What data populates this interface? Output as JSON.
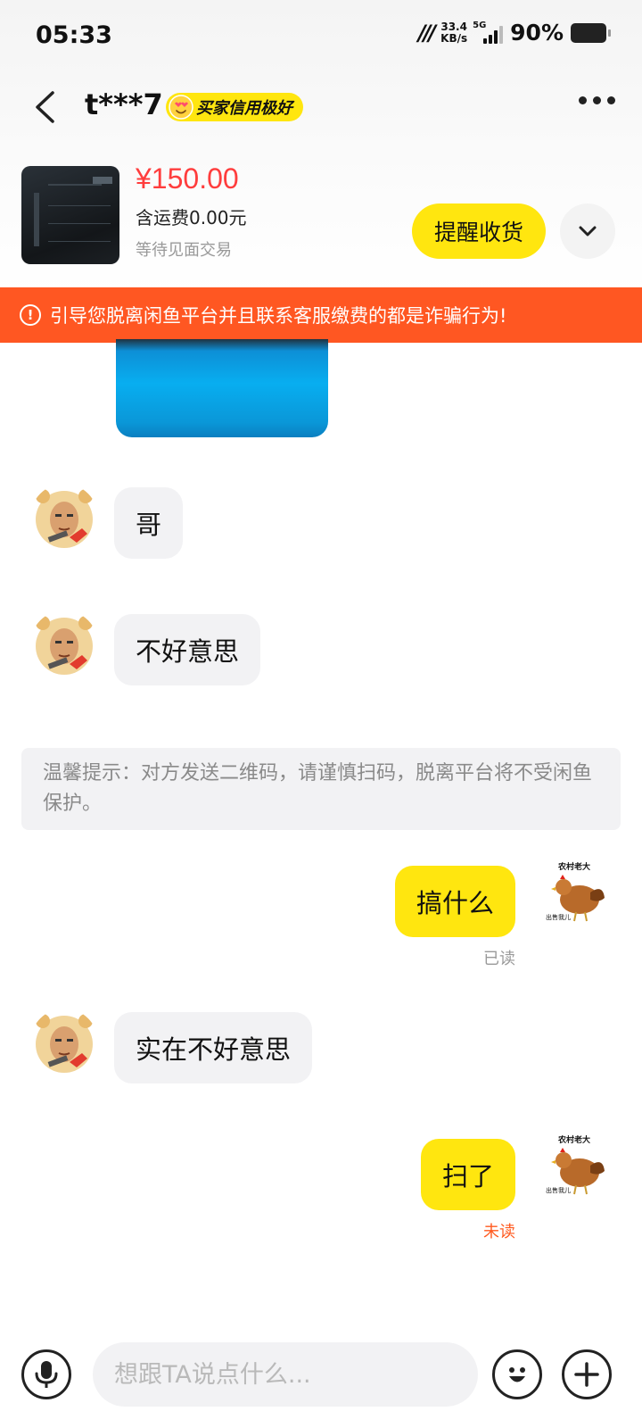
{
  "status_bar": {
    "time": "05:33",
    "net_speed_value": "33.4",
    "net_speed_unit": "KB/s",
    "network_type": "5G",
    "battery_percent": "90%"
  },
  "header": {
    "username": "t***7",
    "credit_badge": "买家信用极好"
  },
  "product": {
    "price": "¥150.00",
    "shipping": "含运费0.00元",
    "status": "等待见面交易",
    "remind_button": "提醒收货"
  },
  "warning": {
    "text": "引导您脱离闲鱼平台并且联系客服缴费的都是诈骗行为!"
  },
  "messages": {
    "m1": "哥",
    "m2": "不好意思",
    "tip": "温馨提示：对方发送二维码，请谨慎扫码，脱离平台将不受闲鱼保护。",
    "m3": "搞什么",
    "m3_state": "已读",
    "m4": "实在不好意思",
    "m5": "扫了",
    "m5_state": "未读",
    "my_avatar_caption_top": "农村老大",
    "my_avatar_caption_bottom": "出售我儿"
  },
  "input": {
    "placeholder": "想跟TA说点什么..."
  },
  "colors": {
    "accent_yellow": "#ffe60f",
    "price_red": "#ff3d3d",
    "warning_orange": "#ff5722",
    "unread_red": "#ff5a1f",
    "read_gray": "#999999"
  }
}
